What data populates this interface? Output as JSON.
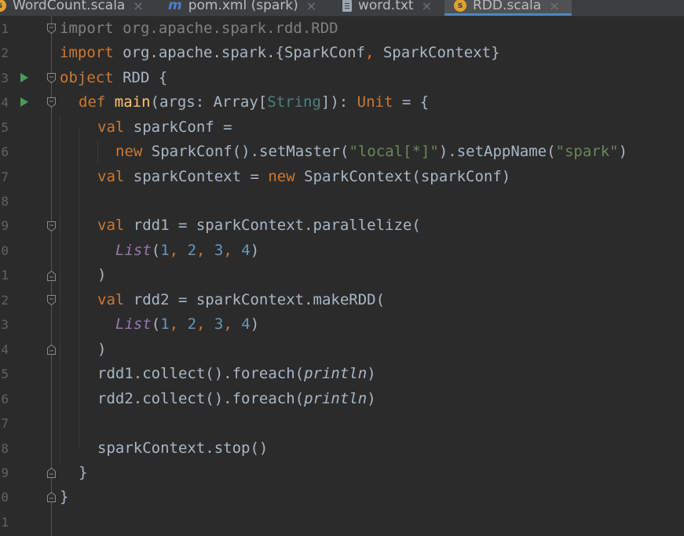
{
  "tabs": [
    {
      "label": "WordCount.scala",
      "icon": "scala-file-icon",
      "active": false
    },
    {
      "label": "pom.xml (spark)",
      "icon": "maven-icon",
      "active": false
    },
    {
      "label": "word.txt",
      "icon": "text-file-icon",
      "active": false
    },
    {
      "label": "RDD.scala",
      "icon": "scala-file-icon",
      "active": true
    }
  ],
  "tab_close_glyph": "×",
  "line_numbers": [
    "1",
    "2",
    "3",
    "4",
    "5",
    "6",
    "7",
    "8",
    "9",
    "0",
    "1",
    "2",
    "3",
    "4",
    "5",
    "6",
    "7",
    "8",
    "9",
    "0",
    "1"
  ],
  "code": {
    "l1": {
      "kw": "import",
      "rest": " org.apache.spark.rdd.RDD"
    },
    "l2": {
      "kw": "import",
      "pre": " org.apache.spark.{SparkConf",
      "comma": ",",
      "post": " SparkContext}"
    },
    "l3": {
      "kw": "object",
      "rest": " RDD {"
    },
    "l4": {
      "kw": "def",
      "fn": "main",
      "a": "(args: Array[",
      "typ": "String",
      "b": "]): ",
      "unit": "Unit",
      "c": " = {"
    },
    "l5": {
      "kw": "val",
      "rest": " sparkConf ="
    },
    "l6": {
      "kw": "new",
      "a": " SparkConf().setMaster(",
      "s1": "\"local[*]\"",
      "b": ").setAppName(",
      "s2": "\"spark\"",
      "c": ")"
    },
    "l7": {
      "kw": "val",
      "a": " sparkContext = ",
      "kw2": "new",
      "b": " SparkContext(sparkConf)"
    },
    "l9": {
      "kw": "val",
      "rest": " rdd1 = sparkContext.parallelize("
    },
    "l10": {
      "list": "List",
      "open": "(",
      "n1": "1",
      "c1": ", ",
      "n2": "2",
      "c2": ", ",
      "n3": "3",
      "c3": ", ",
      "n4": "4",
      "close": ")"
    },
    "l11": {
      "rest": ")"
    },
    "l12": {
      "kw": "val",
      "rest": " rdd2 = sparkContext.makeRDD("
    },
    "l13": {
      "list": "List",
      "open": "(",
      "n1": "1",
      "c1": ", ",
      "n2": "2",
      "c2": ", ",
      "n3": "3",
      "c3": ", ",
      "n4": "4",
      "close": ")"
    },
    "l14": {
      "rest": ")"
    },
    "l15": {
      "a": "rdd1.collect().foreach(",
      "fn": "println",
      "b": ")"
    },
    "l16": {
      "a": "rdd2.collect().foreach(",
      "fn": "println",
      "b": ")"
    },
    "l18": {
      "rest": "sparkContext.stop()"
    },
    "l19": {
      "rest": "}"
    },
    "l20": {
      "rest": "}"
    }
  },
  "colors": {
    "background": "#2b2b2b",
    "keyword": "#cc7832",
    "function": "#ffc66d",
    "string": "#6a8759",
    "number": "#6897bb",
    "italic_member": "#9876aa",
    "run": "#499c54"
  }
}
